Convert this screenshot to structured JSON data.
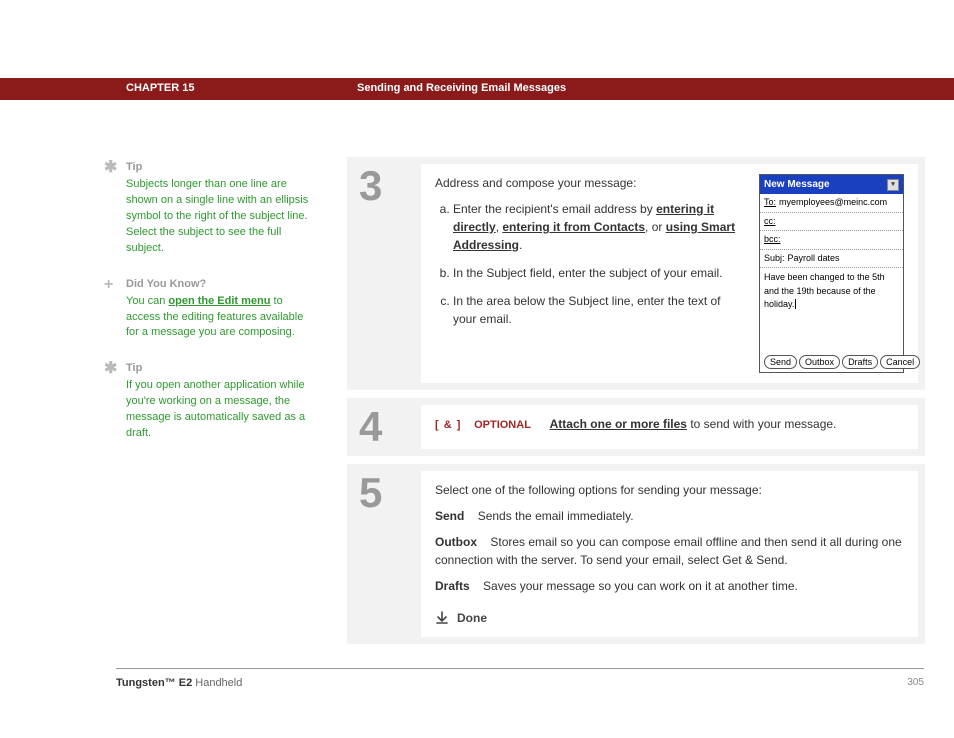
{
  "header": {
    "chapter": "CHAPTER 15",
    "title": "Sending and Receiving Email Messages"
  },
  "sidebar": {
    "tips": [
      {
        "icon": "✱",
        "heading": "Tip",
        "text_parts": [
          {
            "t": "Subjects longer than one line are shown on a single line with an ellipsis symbol to the right of the subject line. Select the subject to see the full subject."
          }
        ]
      },
      {
        "icon": "+",
        "heading": "Did You Know?",
        "text_parts": [
          {
            "t": "You can "
          },
          {
            "t": "open the Edit menu",
            "link": true
          },
          {
            "t": " to access the editing features available for a message you are composing."
          }
        ]
      },
      {
        "icon": "✱",
        "heading": "Tip",
        "text_parts": [
          {
            "t": "If you open another application while you're working on a message, the message is automatically saved as a draft."
          }
        ]
      }
    ]
  },
  "step3": {
    "num": "3",
    "intro": "Address and compose your message:",
    "items": [
      {
        "parts": [
          {
            "t": "Enter the recipient's email address by "
          },
          {
            "t": "entering it directly",
            "link": true
          },
          {
            "t": ", "
          },
          {
            "t": "entering it from Contacts",
            "link": true
          },
          {
            "t": ", or "
          },
          {
            "t": "using Smart Addressing",
            "link": true
          },
          {
            "t": "."
          }
        ]
      },
      {
        "parts": [
          {
            "t": "In the Subject field, enter the subject of your email."
          }
        ]
      },
      {
        "parts": [
          {
            "t": "In the area below the Subject line, enter the text of your email."
          }
        ]
      }
    ]
  },
  "screenshot": {
    "title": "New Message",
    "to_label": "To:",
    "to_val": "myemployees@meinc.com",
    "cc_label": "cc:",
    "cc_val": "",
    "bcc_label": "bcc:",
    "bcc_val": "",
    "subj_label": "Subj:",
    "subj_val": "Payroll dates",
    "body": "Have been changed to the 5th and the 19th because of the holiday.",
    "buttons": [
      "Send",
      "Outbox",
      "Drafts",
      "Cancel"
    ]
  },
  "step4": {
    "num": "4",
    "brackets": "[ & ]",
    "optional": "OPTIONAL",
    "link_text": "Attach one or more files",
    "suffix": " to send with your message."
  },
  "step5": {
    "num": "5",
    "intro": "Select one of the following options for sending your message:",
    "defs": [
      {
        "label": "Send",
        "text": "Sends the email immediately."
      },
      {
        "label": "Outbox",
        "text": "Stores email so you can compose email offline and then send it all during one connection with the server. To send your email, select Get & Send."
      },
      {
        "label": "Drafts",
        "text": "Saves your message so you can work on it at another time."
      }
    ],
    "done": "Done"
  },
  "footer": {
    "product_bold": "Tungsten™ E2",
    "product_rest": " Handheld",
    "page": "305"
  }
}
